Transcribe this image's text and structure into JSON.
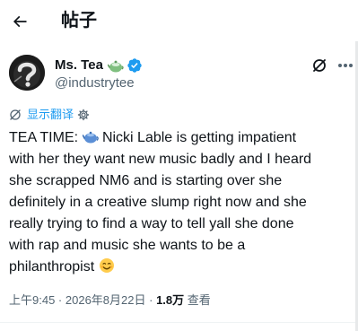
{
  "header": {
    "title": "帖子",
    "back_icon": "arrow-left-icon"
  },
  "author": {
    "display_name": "Ms. Tea",
    "handle": "@industrytee",
    "name_emoji": "teapot-emoji",
    "badge": "verified-badge-icon",
    "badge_color": "#1d9bf0"
  },
  "actions": {
    "grok_icon": "grok-icon",
    "more_icon": "more-options-icon"
  },
  "translate": {
    "label": "显示翻译",
    "link_color": "#1d9bf0"
  },
  "tweet": {
    "lines": [
      {
        "before": "TEA TIME: ",
        "emoji": "teapot-emoji",
        "after": " Nicki Lable is getting impatient"
      },
      {
        "text": "with her they want new music badly and I heard"
      },
      {
        "text": "she scrapped NM6 and is starting over she"
      },
      {
        "text": "definitely in a creative slump right now and she"
      },
      {
        "text": "really trying to find a way to tell yall she done"
      },
      {
        "text": "with rap and music she wants to be a"
      },
      {
        "before": "philanthropist ",
        "emoji": "smiling-face-emoji",
        "after": ""
      }
    ]
  },
  "meta": {
    "time": "上午9:45",
    "separator": " · ",
    "date": "2026年8月22日",
    "separator2": " · ",
    "views_count": "1.8万",
    "views_label": " 查看"
  },
  "colors": {
    "text": "#0f1419",
    "secondary": "#536471",
    "accent": "#1d9bf0"
  }
}
